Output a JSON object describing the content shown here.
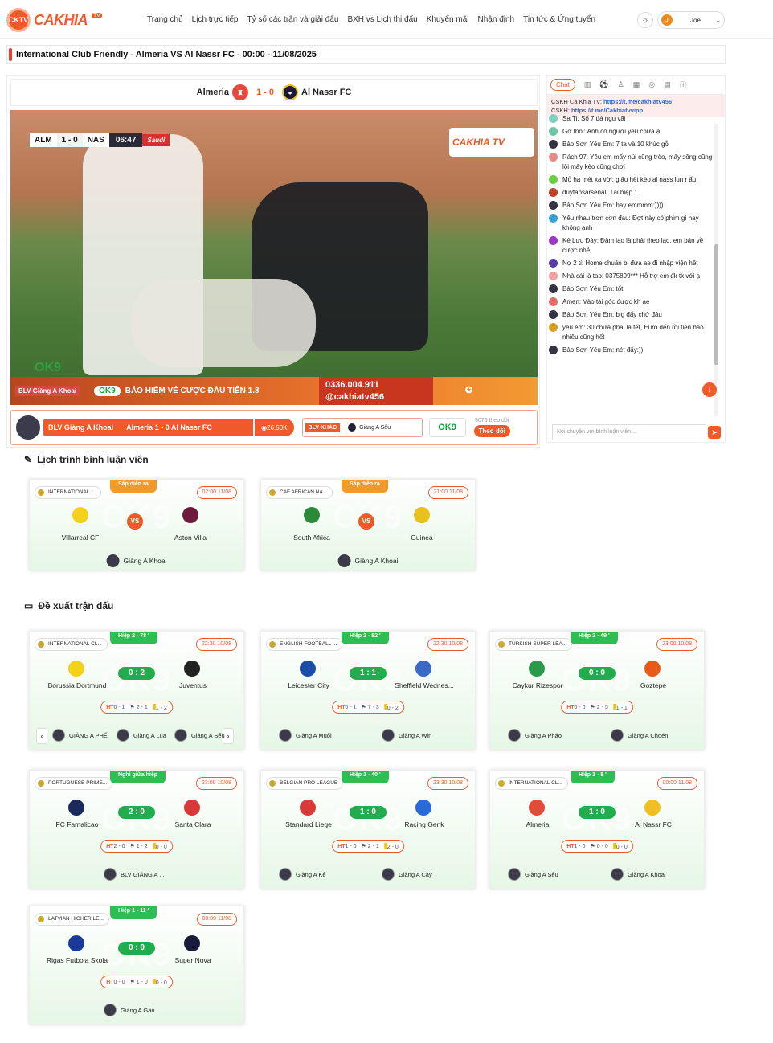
{
  "header": {
    "logo_text": "CAKHIA",
    "logo_badge": "TV",
    "logo_ball": "CKTV",
    "nav": [
      "Trang chủ",
      "Lịch trực tiếp",
      "Tỷ số các trận và giải đấu",
      "BXH vs Lịch thi đấu",
      "Khuyến mãi",
      "Nhận định",
      "Tin tức & Ứng tuyển"
    ],
    "theme_icon": "sun-icon",
    "user": {
      "initial": "J",
      "name": "Joe"
    }
  },
  "page_title": "International Club Friendly - Almeria VS Al Nassr FC - 00:00 - 11/08/2025",
  "match": {
    "home": "Almeria",
    "away": "Al Nassr FC",
    "score": "1 - 0",
    "overlay": {
      "home_abbr": "ALM",
      "away_abbr": "NAS",
      "score": "1 - 0",
      "clock": "06:47",
      "sponsor": "Saudi"
    },
    "watermark": "CAKHIA TV",
    "ok9": "OK9",
    "banner": {
      "blv": "BLV Giàng A Khoai",
      "ok9": "OK9",
      "promo": "BẢO HIỂM VÉ CƯỢC ĐẦU TIÊN 1.8",
      "phone": "0336.004.911",
      "telegram": "@cakhiatv456"
    },
    "info": {
      "commentator": "BLV Giàng A Khoai",
      "match": "Almeria 1 - 0 Al Nassr FC",
      "views": "26.50K",
      "other_label": "BLV KHÁC",
      "other_name": "Giàng A Sếu",
      "ok9": "OK9",
      "followers": "5076 theo dõi",
      "follow": "Theo dõi"
    }
  },
  "chat": {
    "tab": "Chat",
    "cskh1_label": "CSKH Cà Khịa TV:",
    "cskh1_link": "https://t.me/cakhiatv456",
    "cskh2_label": "CSKH:",
    "cskh2_link": "https://t.me/Cakhiatvvipp",
    "messages": [
      {
        "user": "Sa Tị",
        "text": "Số 7 đá ngu vãi",
        "color": "#7ed3c0"
      },
      {
        "user": "Gờ thôi",
        "text": "Anh có người yêu chưa ạ",
        "color": "#6dc7a6"
      },
      {
        "user": "Bảo Sơn Yêu Em",
        "text": "7 ta và 10 khúc gỗ",
        "color": "#334"
      },
      {
        "user": "Rách 97",
        "text": "Yêu em mấy núi cũng trèo, mấy sông cũng lội mấy kèo cũng chơi",
        "color": "#e88a8a"
      },
      {
        "user": "Mỏ ha mét xa vời",
        "text": "giấu hết kèo al nass lun r ấu",
        "color": "#6ccf3c"
      },
      {
        "user": "duyfansarsenal",
        "text": "Tài hiệp 1",
        "color": "#b42"
      },
      {
        "user": "Bảo Sơn Yêu Em",
        "text": "hay emmmm:))))",
        "color": "#334"
      },
      {
        "user": "Yêu nhau trơn cơn đau",
        "text": "Đợt này có phim gì hay không anh",
        "color": "#3aa0d8"
      },
      {
        "user": "Kẻ Lưu Đày",
        "text": "Đâm lao là phải theo lao, em bán về cược nhé",
        "color": "#9a38c8"
      },
      {
        "user": "Nợ 2 tỉ",
        "text": "Home chuẩn bị đưa ae đi nhập viện hết",
        "color": "#5a3ea8"
      },
      {
        "user": "Nhà cái là tao",
        "text": "0375899*** Hỗ trợ em đk tk với ạ",
        "color": "#f2a0a0"
      },
      {
        "user": "Bảo Sơn Yêu Em",
        "text": "tốt",
        "color": "#334"
      },
      {
        "user": "Amen",
        "text": "Vào tài góc được kh ae",
        "color": "#e86a6a"
      },
      {
        "user": "Bảo Sơn Yêu Em",
        "text": "big đấy chứ đâu",
        "color": "#334"
      },
      {
        "user": "yêu em",
        "text": "30 chưa phải là tết, Euro đến rồi tiền bao nhiêu cũng hết",
        "color": "#d4a020"
      },
      {
        "user": "Bảo Sơn Yêu Em",
        "text": "nét đấy:))",
        "color": "#334"
      }
    ],
    "input_placeholder": "Nói chuyện với bình luận viên ..."
  },
  "schedule": {
    "title": "Lịch trình bình luận viên",
    "cards": [
      {
        "league": "INTERNATIONAL ...",
        "status": "Sắp diễn ra",
        "time": "02:00 11/08",
        "home": "Villarreal CF",
        "away": "Aston Villa",
        "vs": "VS",
        "blv": "Giàng A Khoai",
        "home_color": "#f5d21a",
        "away_color": "#6e1a3a"
      },
      {
        "league": "CAF AFRICAN NA...",
        "status": "Sắp diễn ra",
        "time": "21:00 11/08",
        "home": "South Africa",
        "away": "Guinea",
        "vs": "VS",
        "blv": "Giàng A Khoai",
        "home_color": "#2a8a3a",
        "away_color": "#e8c21a"
      }
    ]
  },
  "suggest": {
    "title": "Đề xuất trận đấu",
    "cards": [
      {
        "league": "INTERNATIONAL CL...",
        "status": "Hiệp 2 - 78 '",
        "time": "22:30 10/08",
        "home": "Borussia Dortmund",
        "away": "Juventus",
        "score": "0 : 2",
        "ht": "0 - 1",
        "corner": "2 - 1",
        "card": "1 - 2",
        "blvs": [
          "GIÀNG A PHẾ",
          "Giàng A Lúa",
          "Giàng A Sếu"
        ],
        "home_color": "#f5d21a",
        "away_color": "#222"
      },
      {
        "league": "ENGLISH FOOTBALL ...",
        "status": "Hiệp 2 - 82 '",
        "time": "22:30 10/08",
        "home": "Leicester City",
        "away": "Sheffield Wednes...",
        "score": "1 : 1",
        "ht": "0 - 1",
        "corner": "7 - 3",
        "card": "0 - 2",
        "blvs": [
          "Giàng A Muối",
          "Giàng A Win"
        ],
        "home_color": "#1a4ea8",
        "away_color": "#3a6ac8"
      },
      {
        "league": "TURKISH SUPER LEA...",
        "status": "Hiệp 2 - 49 '",
        "time": "23:00 10/08",
        "home": "Caykur Rizespor",
        "away": "Goztepe",
        "score": "0 : 0",
        "ht": "0 - 0",
        "corner": "2 - 5",
        "card": "1 - 1",
        "blvs": [
          "Giàng A Pháo",
          "Giàng A Choén"
        ],
        "home_color": "#2a9a4a",
        "away_color": "#e85a1a"
      },
      {
        "league": "PORTUGUESE PRIME...",
        "status": "Nghỉ giữa hiệp",
        "time": "23:00 10/08",
        "home": "FC Famalicao",
        "away": "Santa Clara",
        "score": "2 : 0",
        "ht": "2 - 0",
        "corner": "1 - 2",
        "card": "0 - 0",
        "blvs": [
          "BLV GIÀNG A ..."
        ],
        "home_color": "#1a2a5a",
        "away_color": "#d83a3a"
      },
      {
        "league": "BELGIAN PRO LEAGUE",
        "status": "Hiệp 1 - 40 '",
        "time": "23:30 10/08",
        "home": "Standard Liege",
        "away": "Racing Genk",
        "score": "1 : 0",
        "ht": "1 - 0",
        "corner": "2 - 1",
        "card": "2 - 0",
        "blvs": [
          "Giàng A Kê",
          "Giàng A Cày"
        ],
        "home_color": "#d83a3a",
        "away_color": "#2a6ad8"
      },
      {
        "league": "INTERNATIONAL CL...",
        "status": "Hiệp 1 - 8 '",
        "time": "00:00 11/08",
        "home": "Almeria",
        "away": "Al Nassr FC",
        "score": "1 : 0",
        "ht": "1 - 0",
        "corner": "0 - 0",
        "card": "0 - 0",
        "blvs": [
          "Giàng A Sếu",
          "Giàng A Khoai"
        ],
        "home_color": "#e34a3a",
        "away_color": "#f0c020"
      },
      {
        "league": "LATVIAN HIGHER LE...",
        "status": "Hiệp 1 - 11 '",
        "time": "00:00 11/08",
        "home": "Rigas Futbola Skola",
        "away": "Super Nova",
        "score": "0 : 0",
        "ht": "0 - 0",
        "corner": "1 - 0",
        "card": "0 - 0",
        "blvs": [
          "Giàng A Gấu"
        ],
        "home_color": "#1a3a9a",
        "away_color": "#1a1a3a"
      }
    ],
    "watermark": "OK9",
    "ht_label": "HT"
  }
}
